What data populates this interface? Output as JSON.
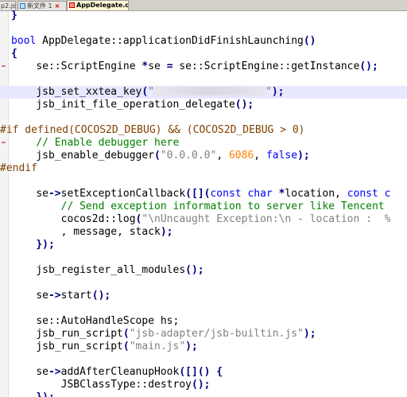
{
  "tabs": [
    {
      "label": "p2.js",
      "active": false,
      "icon": "file-icon"
    },
    {
      "label": "新文件 1",
      "active": false,
      "icon": "file-icon"
    },
    {
      "label": "AppDelegate.cpp",
      "active": true,
      "icon": "file-icon"
    }
  ],
  "editor": {
    "code": {
      "l1_brace": "}",
      "l3_bool": "bool",
      "l3_sig": " AppDelegate::applicationDidFinishLaunching",
      "l3_parens": "()",
      "l4_brace": "{",
      "l5_a": "se::ScriptEngine ",
      "l5_star": "*",
      "l5_b": "se ",
      "l5_eq": "=",
      "l5_c": " se::ScriptEngine::getInstance",
      "l5_d": "();",
      "l7_a": "jsb_set_xxtea_key",
      "l7_b": "(",
      "l7_str1": "\"",
      "l7_str2": "\"",
      "l7_end": ");",
      "l8_a": "jsb_init_file_operation_delegate",
      "l8_b": "();",
      "l10_if": "#if defined(COCOS2D_DEBUG) && (COCOS2D_DEBUG > 0)",
      "l11_cm": "// Enable debugger here",
      "l12_a": "jsb_enable_debugger",
      "l12_b": "(",
      "l12_str": "\"0.0.0.0\"",
      "l12_c": ", ",
      "l12_num": "6086",
      "l12_d": ", ",
      "l12_false": "false",
      "l12_e": ");",
      "l13_endif": "#endif",
      "l15_a": "se",
      "l15_arrow": "->",
      "l15_b": "setExceptionCallback",
      "l15_c": "([](",
      "l15_const1": "const",
      "l15_char": " char ",
      "l15_star": "*",
      "l15_d": "location, ",
      "l15_const2": "const c",
      "l16_cm": "// Send exception information to server like Tencent",
      "l17_a": "cocos2d::log",
      "l17_b": "(",
      "l17_str": "\"\\nUncaught Exception:\\n - location :  %",
      "l18_a": ", message, stack",
      "l18_b": ");",
      "l19_a": "});",
      "l21_a": "jsb_register_all_modules",
      "l21_b": "();",
      "l23_a": "se",
      "l23_arrow": "->",
      "l23_b": "start",
      "l23_c": "();",
      "l25_a": "se::AutoHandleScope hs;",
      "l26_a": "jsb_run_script",
      "l26_b": "(",
      "l26_str": "\"jsb-adapter/jsb-builtin.js\"",
      "l26_c": ");",
      "l27_a": "jsb_run_script",
      "l27_b": "(",
      "l27_str": "\"main.js\"",
      "l27_c": ");",
      "l29_a": "se",
      "l29_arrow": "->",
      "l29_b": "addAfterCleanupHook",
      "l29_c": "([]() {",
      "l30_a": "JSBClassType::destroy",
      "l30_b": "();",
      "l31_a": "});"
    },
    "fold_markers": {
      "minus": "−",
      "bar": "|"
    }
  }
}
